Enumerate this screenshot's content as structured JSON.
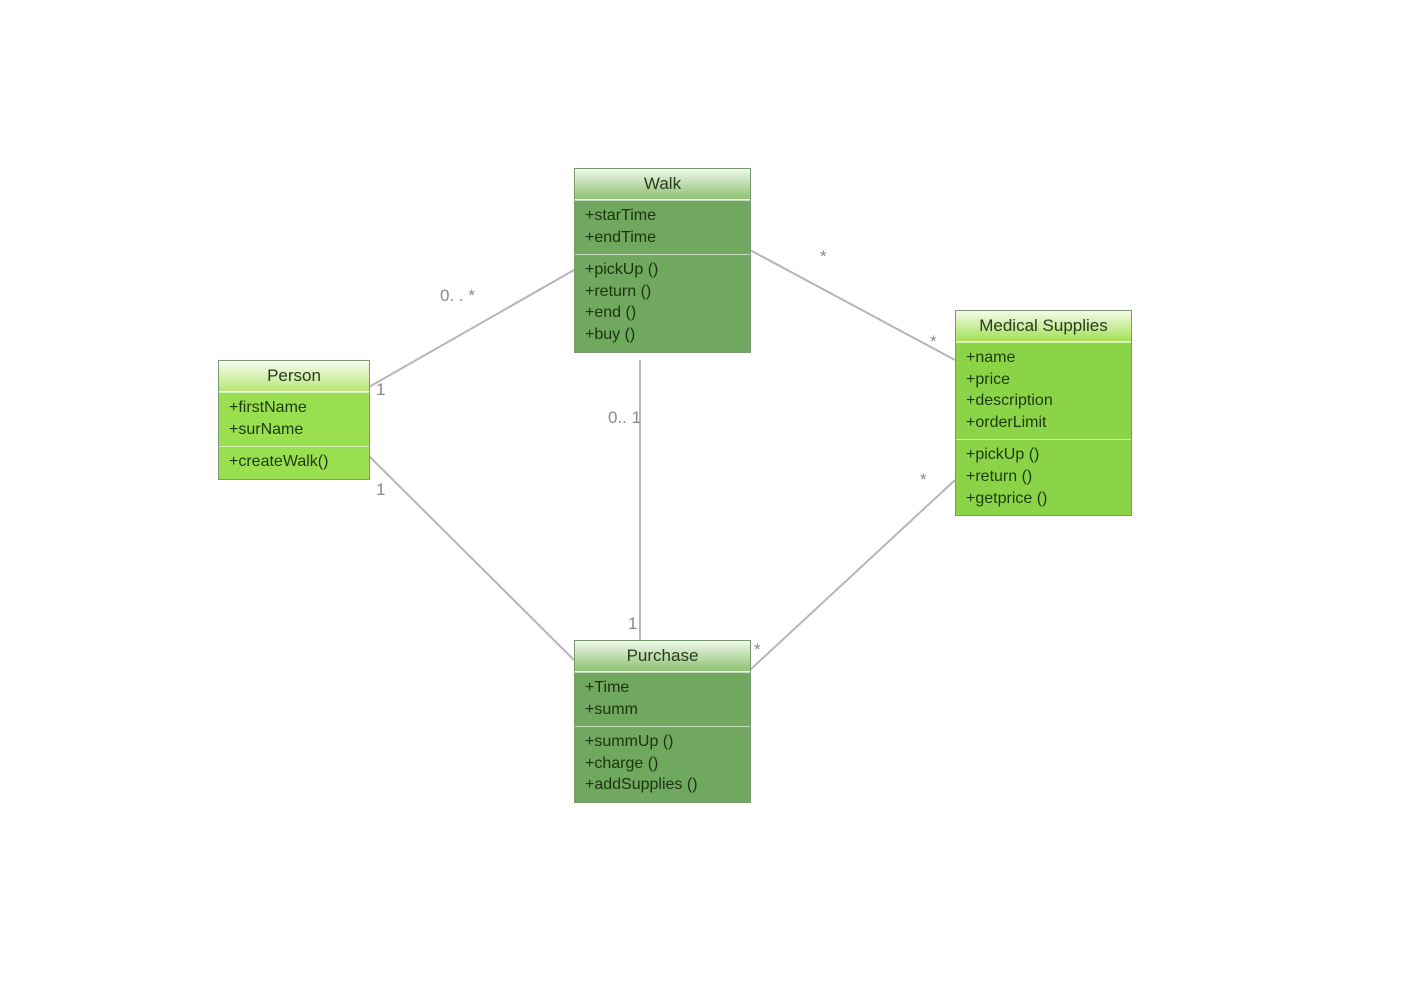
{
  "classes": {
    "person": {
      "title": "Person",
      "attributes": [
        "+firstName",
        "+surName"
      ],
      "methods": [
        "+createWalk()"
      ]
    },
    "walk": {
      "title": "Walk",
      "attributes": [
        "+starTime",
        "+endTime"
      ],
      "methods": [
        "+pickUp ()",
        "+return ()",
        "+end ()",
        "+buy ()"
      ]
    },
    "purchase": {
      "title": "Purchase",
      "attributes": [
        "+Time",
        "+summ"
      ],
      "methods": [
        "+summUp ()",
        "+charge ()",
        "+addSupplies ()"
      ]
    },
    "medical": {
      "title": "Medical Supplies",
      "attributes": [
        "+name",
        "+price",
        "+description",
        "+orderLimit"
      ],
      "methods": [
        "+pickUp ()",
        "+return ()",
        "+getprice ()"
      ]
    }
  },
  "multiplicities": {
    "person_walk_person": "1",
    "person_walk_walk": "0. . *",
    "person_purchase_person": "1",
    "walk_purchase_walk": "0.. 1",
    "walk_purchase_purchase": "1",
    "walk_medical_walk": "*",
    "walk_medical_medical": "*",
    "purchase_medical_purchase": "*",
    "purchase_medical_medical": "*"
  }
}
